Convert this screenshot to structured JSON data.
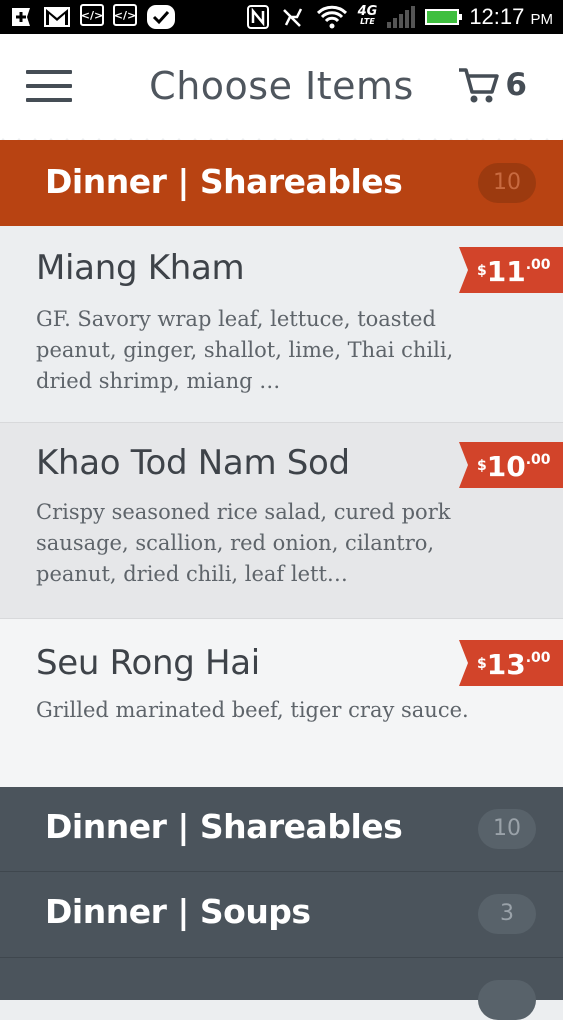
{
  "status_bar": {
    "time": "12:17",
    "ampm": "PM",
    "network": "4G",
    "network_sub": "LTE",
    "icons": [
      "plus-icon",
      "mail-icon",
      "code-icon",
      "code-icon",
      "check-icon",
      "nfc-icon",
      "mute-icon",
      "wifi-icon",
      "signal-icon",
      "battery-icon"
    ]
  },
  "header": {
    "title": "Choose Items",
    "cart_count": "6"
  },
  "active_category": {
    "title": "Dinner | Shareables",
    "count": "10",
    "badge_color": "#9c3a0f",
    "accent": "#b84312"
  },
  "items": [
    {
      "name": "Miang Kham",
      "description": "GF. Savory wrap leaf, lettuce, toasted peanut, ginger, shallot, lime, Thai chili, dried shrimp, miang …",
      "currency": "$",
      "price_dollars": "11",
      "price_cents": ".00"
    },
    {
      "name": "Khao Tod Nam Sod",
      "description": "Crispy seasoned rice salad, cured pork sausage, scallion, red onion, cilantro, peanut, dried chili, leaf lett…",
      "currency": "$",
      "price_dollars": "10",
      "price_cents": ".00"
    },
    {
      "name": "Seu Rong Hai",
      "description": "Grilled marinated beef, tiger cray sauce.",
      "currency": "$",
      "price_dollars": "13",
      "price_cents": ".00"
    }
  ],
  "categories": [
    {
      "title": "Dinner | Shareables",
      "count": "10"
    },
    {
      "title": "Dinner | Soups",
      "count": "3"
    }
  ],
  "colors": {
    "price_tag": "#d2442a",
    "category_bg": "#4b545c"
  }
}
